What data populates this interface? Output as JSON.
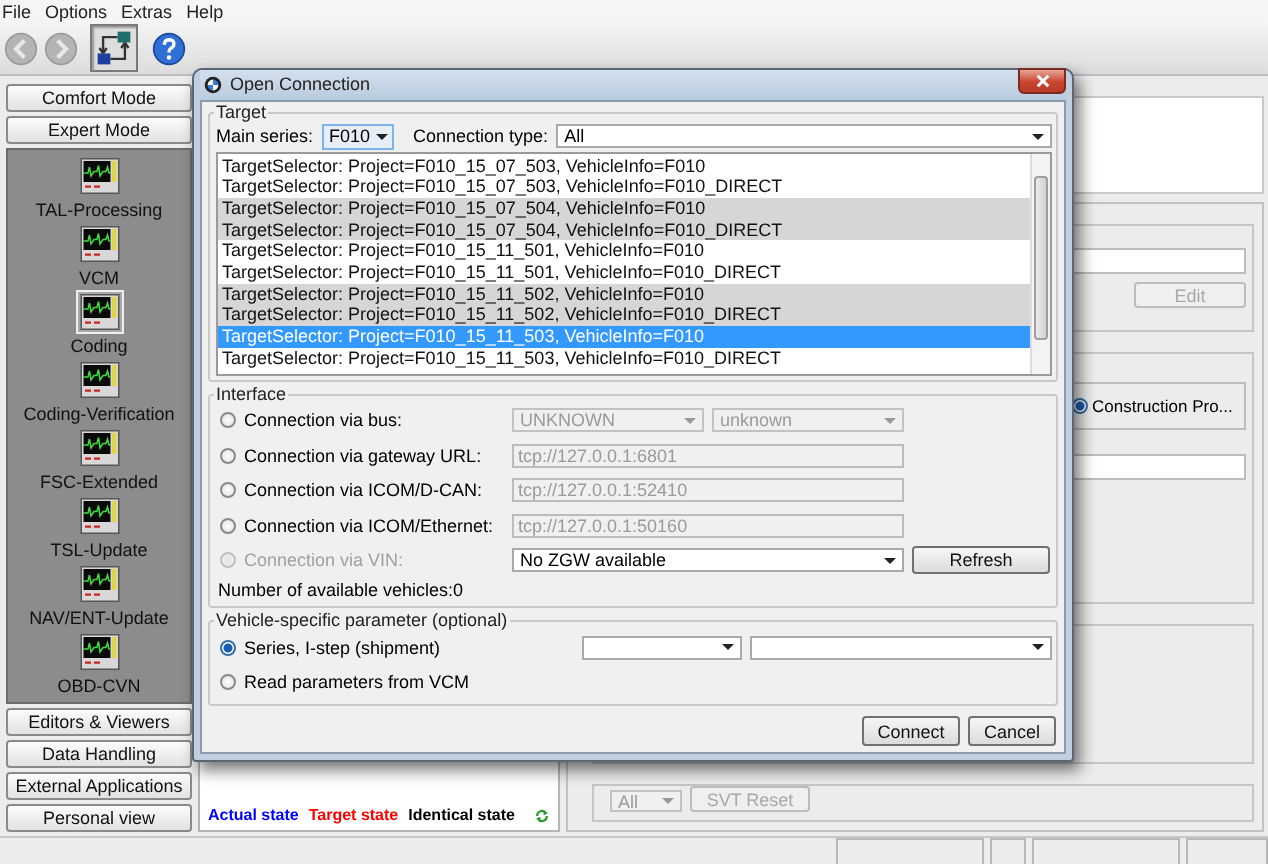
{
  "menu": [
    {
      "label": "File"
    },
    {
      "label": "Options"
    },
    {
      "label": "Extras"
    },
    {
      "label": "Help"
    }
  ],
  "toolbar": [
    {
      "kind": "back",
      "disabled": true
    },
    {
      "kind": "forward",
      "disabled": true
    },
    {
      "kind": "connection",
      "selected": true
    },
    {
      "kind": "help",
      "disabled": false
    }
  ],
  "sidebar": {
    "top_buttons": [
      "Comfort Mode",
      "Expert Mode"
    ],
    "items": [
      {
        "label": "TAL-Processing",
        "selected": false
      },
      {
        "label": "VCM",
        "selected": false
      },
      {
        "label": "Coding",
        "selected": true
      },
      {
        "label": "Coding-Verification",
        "selected": false
      },
      {
        "label": "FSC-Extended",
        "selected": false
      },
      {
        "label": "TSL-Update",
        "selected": false
      },
      {
        "label": "NAV/ENT-Update",
        "selected": false
      },
      {
        "label": "OBD-CVN",
        "selected": false
      }
    ],
    "bottom_buttons": [
      "Editors & Viewers",
      "Data Handling",
      "External Applications",
      "Personal view"
    ]
  },
  "main": {
    "edit_button": {
      "label": "Edit",
      "disabled": true
    },
    "construction_option": {
      "label": "Construction Pro...",
      "selected": true
    },
    "filter_dropdown": {
      "value": "All"
    },
    "svt_reset_button": {
      "label": "SVT Reset",
      "disabled": true
    },
    "legend": [
      {
        "label": "Actual state",
        "color": "#0000ff"
      },
      {
        "label": "Target state",
        "color": "#ff0000"
      },
      {
        "label": "Identical state",
        "color": "#000000"
      }
    ]
  },
  "dialog": {
    "title": "Open Connection",
    "target": {
      "legend": "Target",
      "main_series_label": "Main series:",
      "main_series": "F010",
      "connection_type_label": "Connection type:",
      "connection_type": "All",
      "items": [
        {
          "text": "TargetSelector: Project=F010_15_07_503, VehicleInfo=F010",
          "selected": false
        },
        {
          "text": "TargetSelector: Project=F010_15_07_503, VehicleInfo=F010_DIRECT",
          "selected": false
        },
        {
          "text": "TargetSelector: Project=F010_15_07_504, VehicleInfo=F010",
          "selected": false
        },
        {
          "text": "TargetSelector: Project=F010_15_07_504, VehicleInfo=F010_DIRECT",
          "selected": false
        },
        {
          "text": "TargetSelector: Project=F010_15_11_501, VehicleInfo=F010",
          "selected": false
        },
        {
          "text": "TargetSelector: Project=F010_15_11_501, VehicleInfo=F010_DIRECT",
          "selected": false
        },
        {
          "text": "TargetSelector: Project=F010_15_11_502, VehicleInfo=F010",
          "selected": false
        },
        {
          "text": "TargetSelector: Project=F010_15_11_502, VehicleInfo=F010_DIRECT",
          "selected": false
        },
        {
          "text": "TargetSelector: Project=F010_15_11_503, VehicleInfo=F010",
          "selected": true
        },
        {
          "text": "TargetSelector: Project=F010_15_11_503, VehicleInfo=F010_DIRECT",
          "selected": false
        }
      ]
    },
    "interface": {
      "legend": "Interface",
      "options": [
        {
          "kind": "dropdowns",
          "label": "Connection via bus:",
          "selected": false,
          "disabled": false,
          "input_disabled": true,
          "values": [
            "UNKNOWN",
            "unknown"
          ]
        },
        {
          "kind": "field",
          "label": "Connection via gateway URL:",
          "selected": false,
          "disabled": false,
          "input_disabled": true,
          "value": "tcp://127.0.0.1:6801"
        },
        {
          "kind": "field",
          "label": "Connection via ICOM/D-CAN:",
          "selected": false,
          "disabled": false,
          "input_disabled": true,
          "value": "tcp://127.0.0.1:52410"
        },
        {
          "kind": "field",
          "label": "Connection via ICOM/Ethernet:",
          "selected": false,
          "disabled": false,
          "input_disabled": true,
          "value": "tcp://127.0.0.1:50160"
        },
        {
          "kind": "dropdown_button",
          "label": "Connection via VIN:",
          "selected": false,
          "disabled": true,
          "input_disabled": false,
          "value": "No ZGW available",
          "button": "Refresh"
        }
      ],
      "count_text": "Number of available vehicles:0"
    },
    "vehicle_parameter": {
      "legend": "Vehicle-specific parameter (optional)",
      "options": [
        {
          "kind": "dropdowns",
          "label": "Series, I-step (shipment)",
          "selected": true
        },
        {
          "kind": "plain",
          "label": "Read parameters from VCM",
          "selected": false
        }
      ]
    },
    "buttons": [
      "Connect",
      "Cancel"
    ]
  }
}
